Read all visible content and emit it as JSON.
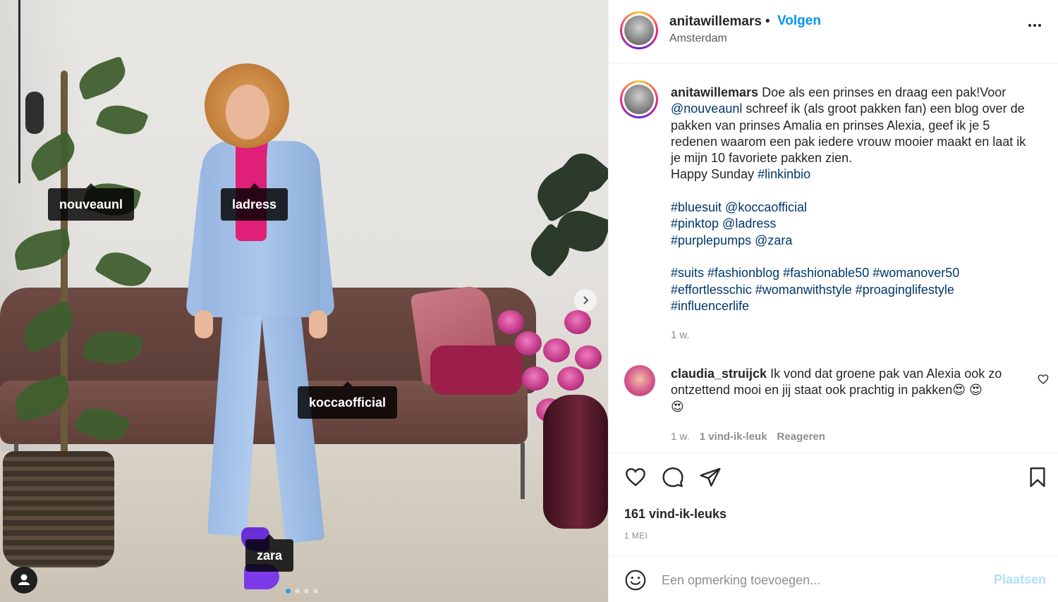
{
  "photo": {
    "tags": [
      "nouveaunl",
      "ladress",
      "koccaofficial",
      "zara"
    ],
    "next_icon": "chevron-right-icon",
    "user_icon": "user-icon",
    "carousel_count": 4,
    "carousel_active": 1
  },
  "header": {
    "username": "anitawillemars",
    "separator": "•",
    "follow_label": "Volgen",
    "location": "Amsterdam",
    "more_icon": "more-options-icon",
    "more_label": "•••"
  },
  "caption": {
    "username": "anitawillemars",
    "l1": " Doe als een prinses en draag een pak!Voor",
    "mention1": "@nouveaunl",
    "l2": " schreef ik (als groot pakken fan) een blog over de",
    "l3": "pakken van prinses Amalia en prinses Alexia, geef ik je 5",
    "l4": "redenen waarom een pak iedere vrouw mooier maakt en laat ik",
    "l5": "je mijn 10 favoriete pakken zien.",
    "l6": "Happy Sunday ",
    "hashtag1": "#linkinbio",
    "tags_line1": "#bluesuit @koccaofficial",
    "tags_line2": "#pinktop @ladress",
    "tags_line3": "#purplepumps @zara",
    "tags_line4": "#suits #fashionblog #fashionable50 #womanover50",
    "tags_line5": "#effortlesschic #womanwithstyle #proaginglifestyle",
    "tags_line6": "#influencerlife",
    "time": "1 w."
  },
  "comment": {
    "username": "claudia_struijck",
    "text1": " Ik vond dat groene pak van Alexia ook zo",
    "text2": "ontzettend mooi en jij staat ook prachtig in pakken😍 😍",
    "text3": "😍",
    "time": "1 w.",
    "likes": "1 vind-ik-leuk",
    "reply": "Reageren"
  },
  "actions": {
    "likes": "161 vind-ik-leuks",
    "date": "1 MEI",
    "icons": [
      "heart-icon",
      "comment-icon",
      "share-icon",
      "bookmark-icon"
    ]
  },
  "add_comment": {
    "placeholder": "Een opmerking toevoegen...",
    "post_label": "Plaatsen"
  },
  "colors": {
    "accent": "#0095f6",
    "link": "#00376b",
    "muted": "#8e8e8e",
    "post_disabled": "#b2dffc"
  }
}
